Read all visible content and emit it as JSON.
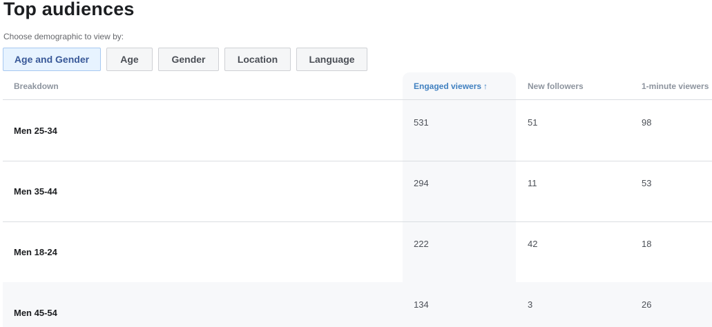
{
  "title": "Top audiences",
  "subtitle": "Choose demographic to view by:",
  "filters": [
    {
      "label": "Age and Gender",
      "active": true
    },
    {
      "label": "Age",
      "active": false
    },
    {
      "label": "Gender",
      "active": false
    },
    {
      "label": "Location",
      "active": false
    },
    {
      "label": "Language",
      "active": false
    }
  ],
  "table": {
    "columns": {
      "breakdown": "Breakdown",
      "engaged": "Engaged viewers",
      "engaged_sort_icon": "↑",
      "followers": "New followers",
      "one_minute": "1-minute viewers"
    },
    "rows": [
      {
        "label": "Men 25-34",
        "engaged": "531",
        "followers": "51",
        "one_minute": "98"
      },
      {
        "label": "Men 35-44",
        "engaged": "294",
        "followers": "11",
        "one_minute": "53"
      },
      {
        "label": "Men 18-24",
        "engaged": "222",
        "followers": "42",
        "one_minute": "18"
      },
      {
        "label": "Men 45-54",
        "engaged": "134",
        "followers": "3",
        "one_minute": "26"
      }
    ]
  },
  "colors": {
    "accent": "#4080c0",
    "active_filter_bg": "#e7f3ff"
  }
}
